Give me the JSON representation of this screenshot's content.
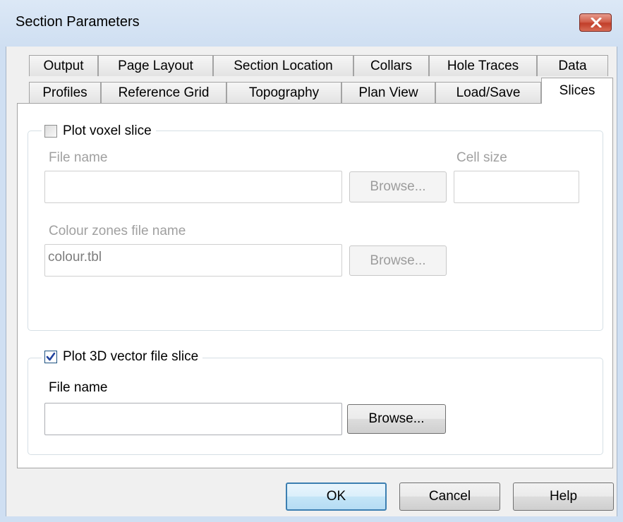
{
  "window": {
    "title": "Section Parameters",
    "close_icon": "close-icon"
  },
  "tabs_row1": [
    "Output",
    "Page Layout",
    "Section Location",
    "Collars",
    "Hole Traces",
    "Data"
  ],
  "tabs_row2": [
    "Profiles",
    "Reference Grid",
    "Topography",
    "Plan View",
    "Load/Save",
    "Slices"
  ],
  "selected_tab": "Slices",
  "voxel": {
    "caption": "Plot voxel slice",
    "checked": false,
    "file_name_label": "File name",
    "file_name_value": "",
    "browse_label": "Browse...",
    "cell_size_label": "Cell size",
    "cell_size_value": "",
    "colour_zones_label": "Colour zones file name",
    "colour_zones_value": "colour.tbl",
    "colour_browse_label": "Browse..."
  },
  "vector": {
    "caption": "Plot 3D vector file slice",
    "checked": true,
    "file_name_label": "File name",
    "file_name_value": "",
    "browse_label": "Browse..."
  },
  "buttons": {
    "ok": "OK",
    "cancel": "Cancel",
    "help": "Help"
  },
  "colors": {
    "title_bar": "#cfdff2",
    "close_button": "#c8432e",
    "default_button_border": "#3c7fb1"
  }
}
